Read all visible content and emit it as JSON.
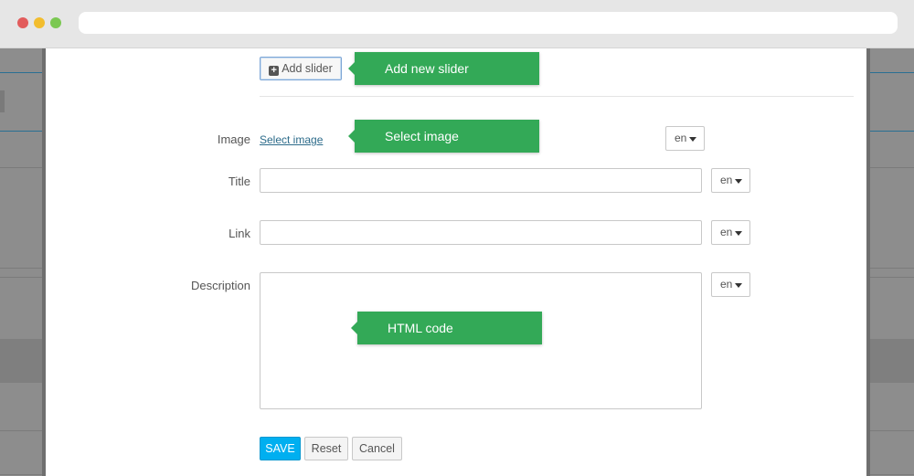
{
  "browser": {
    "dots": [
      "#e25c5c",
      "#f2bd2e",
      "#7bc852"
    ]
  },
  "toolbar": {
    "add_slider_label": "Add slider"
  },
  "callouts": {
    "add_new_slider": "Add new slider",
    "select_image": "Select image",
    "html_code": "HTML code"
  },
  "form": {
    "image_label": "Image",
    "select_image_link": "Select image",
    "title_label": "Title",
    "title_value": "",
    "link_label": "Link",
    "link_value": "",
    "description_label": "Description",
    "description_value": "",
    "lang": "en"
  },
  "actions": {
    "save": "SAVE",
    "reset": "Reset",
    "cancel": "Cancel"
  },
  "colors": {
    "callout": "#33a957",
    "save": "#00aff0"
  }
}
